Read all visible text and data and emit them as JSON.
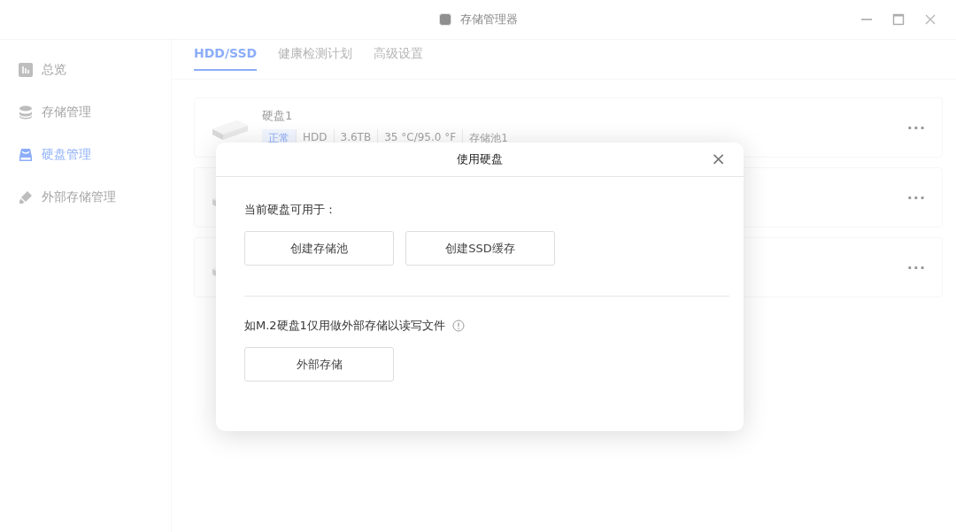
{
  "window": {
    "title": "存储管理器"
  },
  "sidebar": {
    "items": [
      {
        "label": "总览",
        "selected": false
      },
      {
        "label": "存储管理",
        "selected": false
      },
      {
        "label": "硬盘管理",
        "selected": true
      },
      {
        "label": "外部存储管理",
        "selected": false
      }
    ]
  },
  "tabs": [
    {
      "label": "HDD/SSD",
      "selected": true
    },
    {
      "label": "健康检测计划",
      "selected": false
    },
    {
      "label": "高级设置",
      "selected": false
    }
  ],
  "disks": [
    {
      "name": "硬盘1",
      "tags": [
        {
          "text": "正常",
          "kind": "status"
        },
        {
          "text": "HDD",
          "kind": "info"
        },
        {
          "text": "3.6TB",
          "kind": "info"
        },
        {
          "text": "35 °C/95.0 °F",
          "kind": "info"
        },
        {
          "text": "存储池1",
          "kind": "info"
        }
      ],
      "more": "···"
    },
    {
      "more": "···"
    },
    {
      "more": "···"
    }
  ],
  "dialog": {
    "title": "使用硬盘",
    "close": "×",
    "sections": [
      {
        "text": "当前硬盘可用于：",
        "info": false,
        "buttons": [
          "创建存储池",
          "创建SSD缓存"
        ]
      },
      {
        "text": "如M.2硬盘1仅用做外部存储以读写文件",
        "info": true,
        "buttons": [
          "外部存储"
        ]
      }
    ]
  }
}
